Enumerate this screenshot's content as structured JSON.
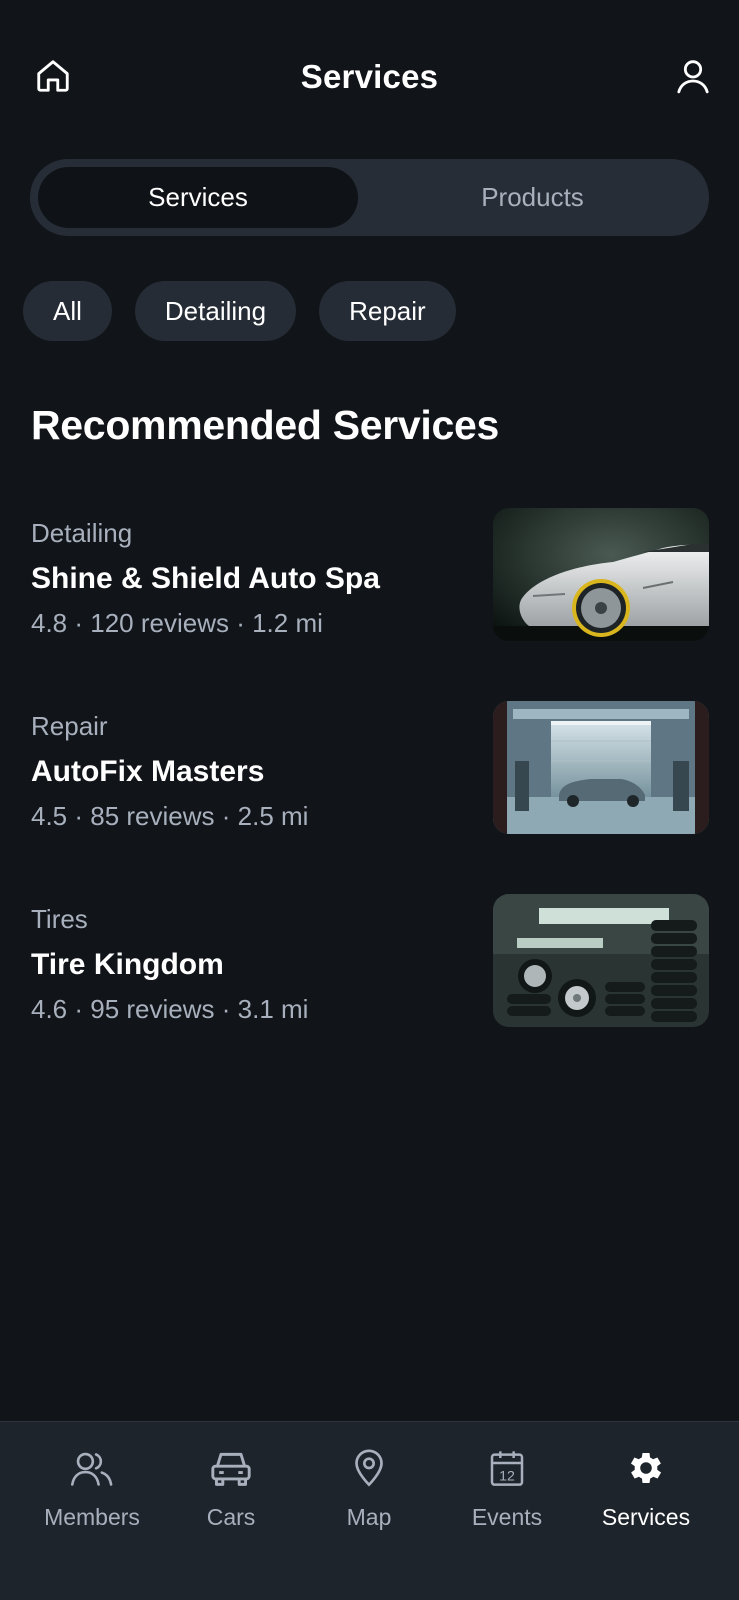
{
  "header": {
    "title": "Services"
  },
  "segmented": {
    "active": "Services",
    "inactive": "Products"
  },
  "filters": [
    "All",
    "Detailing",
    "Repair"
  ],
  "section_title": "Recommended Services",
  "services": [
    {
      "category": "Detailing",
      "name": "Shine & Shield Auto Spa",
      "meta": "4.8 · 120 reviews · 1.2 mi",
      "image": "white-sports-car-photo"
    },
    {
      "category": "Repair",
      "name": "AutoFix Masters",
      "meta": "4.5 · 85 reviews · 2.5 mi",
      "image": "garage-with-car-photo"
    },
    {
      "category": "Tires",
      "name": "Tire Kingdom",
      "meta": "4.6 · 95 reviews · 3.1 mi",
      "image": "tire-stacks-photo"
    }
  ],
  "nav": [
    {
      "label": "Members",
      "icon": "members-icon",
      "active": false
    },
    {
      "label": "Cars",
      "icon": "car-icon",
      "active": false
    },
    {
      "label": "Map",
      "icon": "map-pin-icon",
      "active": false
    },
    {
      "label": "Events",
      "icon": "calendar-icon",
      "active": false,
      "calendar_day": "12"
    },
    {
      "label": "Services",
      "icon": "gear-icon",
      "active": true
    }
  ],
  "colors": {
    "background": "#111419",
    "surface": "#262d36",
    "muted_text": "#a7b0bc",
    "nav_bg": "#1e242c"
  }
}
